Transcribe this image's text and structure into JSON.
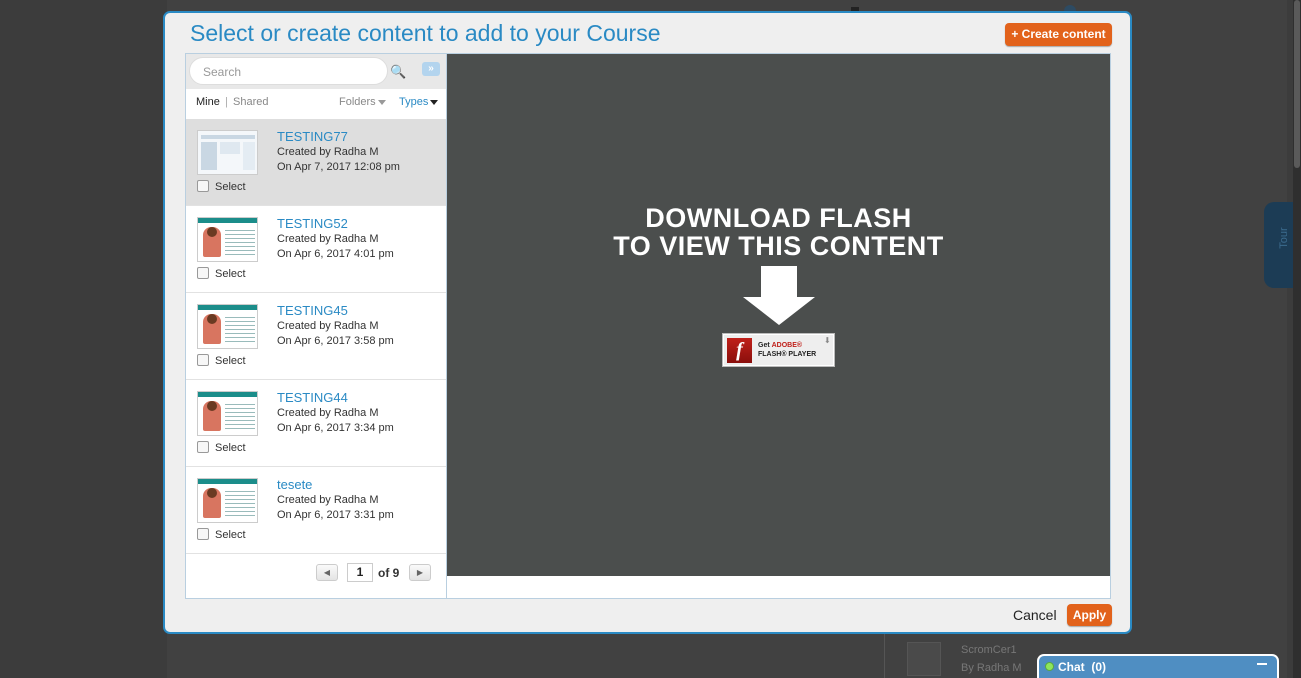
{
  "background": {
    "tour_tab_label": "Tour",
    "bg_item_title": "ScromCer1",
    "bg_item_author": "By Radha M"
  },
  "modal": {
    "title": "Select or create content to add to your Course",
    "create_button": "+ Create content",
    "cancel_label": "Cancel",
    "apply_label": "Apply"
  },
  "search": {
    "placeholder": "Search"
  },
  "filters": {
    "mine": "Mine",
    "separator": "|",
    "shared": "Shared",
    "folders": "Folders",
    "types": "Types"
  },
  "items": [
    {
      "title": "TESTING77",
      "created_by": "Created by Radha M",
      "date": "On Apr 7, 2017 12:08 pm",
      "select_label": "Select",
      "selected": true,
      "thumb": "screen"
    },
    {
      "title": "TESTING52",
      "created_by": "Created by Radha M",
      "date": "On Apr 6, 2017 4:01 pm",
      "select_label": "Select",
      "selected": false,
      "thumb": "tutorial"
    },
    {
      "title": "TESTING45",
      "created_by": "Created by Radha M",
      "date": "On Apr 6, 2017 3:58 pm",
      "select_label": "Select",
      "selected": false,
      "thumb": "tutorial"
    },
    {
      "title": "TESTING44",
      "created_by": "Created by Radha M",
      "date": "On Apr 6, 2017 3:34 pm",
      "select_label": "Select",
      "selected": false,
      "thumb": "tutorial"
    },
    {
      "title": "tesete",
      "created_by": "Created by Radha M",
      "date": "On Apr 6, 2017 3:31 pm",
      "select_label": "Select",
      "selected": false,
      "thumb": "tutorial"
    }
  ],
  "pager": {
    "prev_icon": "◀",
    "next_icon": "▶",
    "current_page": "1",
    "of_text": "of 9"
  },
  "preview": {
    "line1": "DOWNLOAD FLASH",
    "line2": "TO VIEW THIS CONTENT",
    "badge_get": "Get",
    "badge_adobe": "ADOBE®",
    "badge_player": "FLASH® PLAYER",
    "badge_logo": "f"
  },
  "chat": {
    "label": "Chat  (0)"
  },
  "colors": {
    "accent": "#2a8ac4",
    "orange": "#e2621b",
    "preview_bg": "#4b4e4d"
  }
}
